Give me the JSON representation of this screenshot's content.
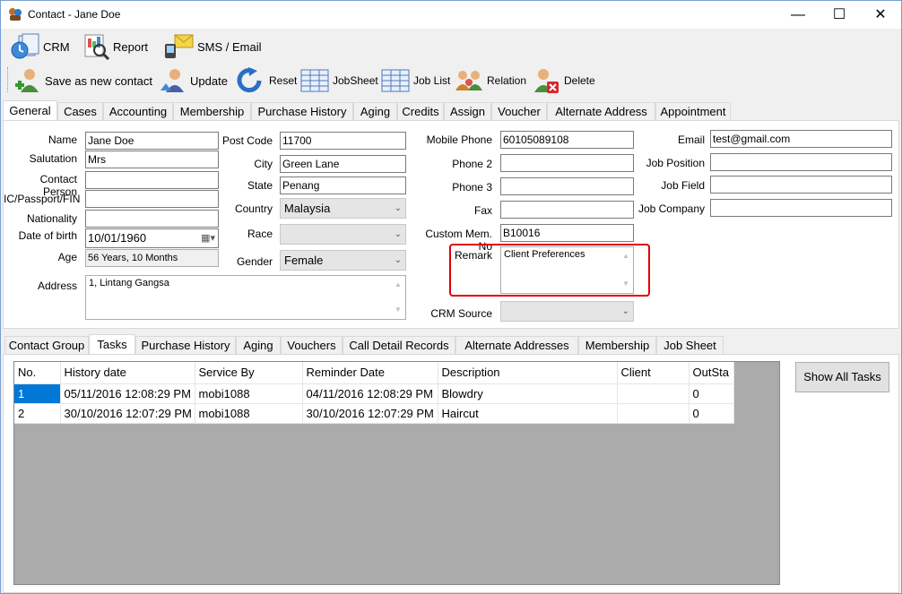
{
  "window": {
    "title": "Contact - Jane Doe"
  },
  "menubar": {
    "crm": "CRM",
    "report": "Report",
    "sms": "SMS / Email"
  },
  "toolbar": {
    "save_new": "Save as new contact",
    "update": "Update",
    "reset": "Reset",
    "jobsheet": "JobSheet",
    "joblist": "Job List",
    "relation": "Relation",
    "delete": "Delete"
  },
  "top_tabs": [
    "General",
    "Cases",
    "Accounting",
    "Membership",
    "Purchase History",
    "Aging",
    "Credits",
    "Assign",
    "Voucher",
    "Alternate Address",
    "Appointment"
  ],
  "form": {
    "name_label": "Name",
    "name": "Jane Doe",
    "salutation_label": "Salutation",
    "salutation": "Mrs",
    "contact_person_label": "Contact Person",
    "contact_person": "",
    "ic_label": "IC/Passport/FIN",
    "ic": "",
    "nationality_label": "Nationality",
    "nationality": "",
    "dob_label": "Date of birth",
    "dob": "10/01/1960",
    "age_label": "Age",
    "age": "56 Years, 10 Months",
    "address_label": "Address",
    "address": "1, Lintang Gangsa",
    "postcode_label": "Post Code",
    "postcode": "11700",
    "city_label": "City",
    "city": "Green Lane",
    "state_label": "State",
    "state": "Penang",
    "country_label": "Country",
    "country": "Malaysia",
    "race_label": "Race",
    "race": "",
    "gender_label": "Gender",
    "gender": "Female",
    "mobile_label": "Mobile Phone",
    "mobile": "60105089108",
    "phone2_label": "Phone 2",
    "phone2": "",
    "phone3_label": "Phone 3",
    "phone3": "",
    "fax_label": "Fax",
    "fax": "",
    "custom_mem_label": "Custom Mem. No",
    "custom_mem": "B10016",
    "remark_label": "Remark",
    "remark": "Client Preferences",
    "crm_source_label": "CRM Source",
    "crm_source": "",
    "email_label": "Email",
    "email": "test@gmail.com",
    "job_position_label": "Job Position",
    "job_position": "",
    "job_field_label": "Job Field",
    "job_field": "",
    "job_company_label": "Job Company",
    "job_company": ""
  },
  "bottom_tabs": [
    "Contact Group",
    "Tasks",
    "Purchase History",
    "Aging",
    "Vouchers",
    "Call Detail Records",
    "Alternate Addresses",
    "Membership",
    "Job Sheet"
  ],
  "tasks": {
    "columns": [
      "No.",
      "History date",
      "Service By",
      "Reminder Date",
      "Description",
      "Client",
      "OutSta"
    ],
    "rows": [
      [
        "1",
        "05/11/2016 12:08:29 PM",
        "mobi1088",
        "04/11/2016 12:08:29 PM",
        "Blowdry",
        "",
        "0"
      ],
      [
        "2",
        "30/10/2016 12:07:29 PM",
        "mobi1088",
        "30/10/2016 12:07:29 PM",
        "Haircut",
        "",
        "0"
      ]
    ],
    "show_all": "Show All Tasks"
  },
  "colors": {
    "highlight_box": "#e00000",
    "selection": "#0078d7"
  }
}
